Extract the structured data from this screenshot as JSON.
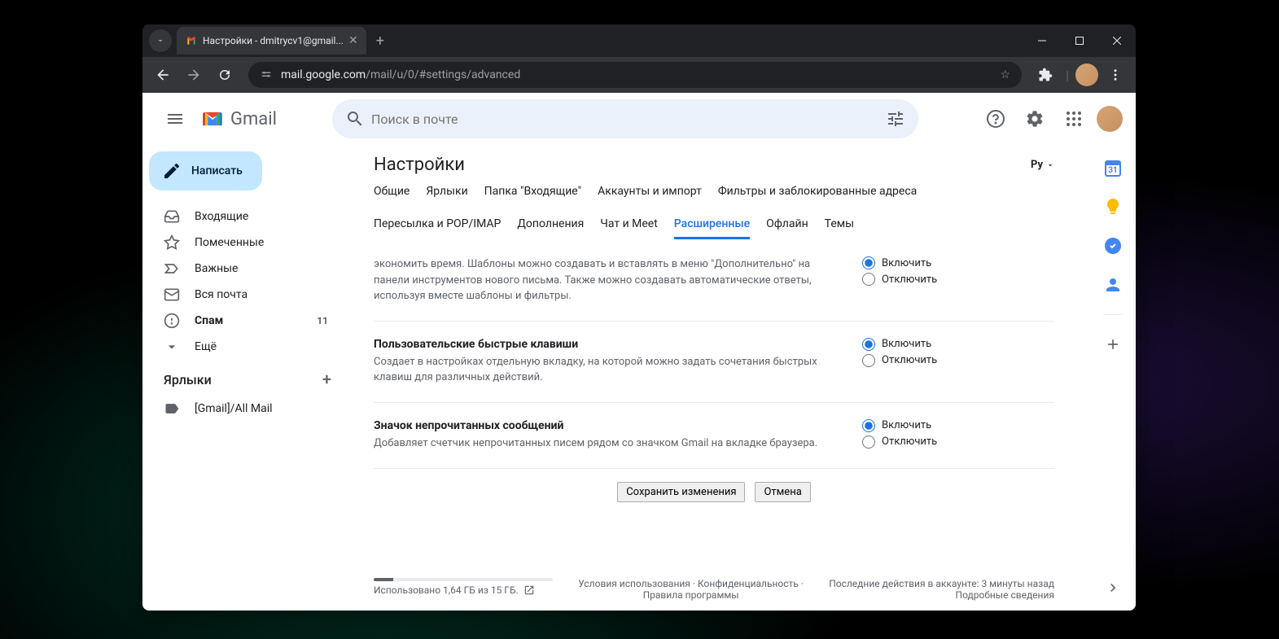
{
  "browser": {
    "tab_title": "Настройки - dmitrycv1@gmail...",
    "url_domain": "mail.google.com",
    "url_path": "/mail/u/0/#settings/advanced"
  },
  "header": {
    "app_name": "Gmail",
    "search_placeholder": "Поиск в почте"
  },
  "sidebar": {
    "compose": "Написать",
    "items": [
      {
        "label": "Входящие",
        "icon": "inbox"
      },
      {
        "label": "Помеченные",
        "icon": "star"
      },
      {
        "label": "Важные",
        "icon": "important"
      },
      {
        "label": "Вся почта",
        "icon": "mail"
      },
      {
        "label": "Спам",
        "icon": "spam",
        "count": "11",
        "bold": true
      },
      {
        "label": "Ещё",
        "icon": "expand"
      }
    ],
    "labels_header": "Ярлыки",
    "labels": [
      {
        "label": "[Gmail]/All Mail"
      }
    ]
  },
  "settings": {
    "title": "Настройки",
    "language": "Ру",
    "tabs": [
      "Общие",
      "Ярлыки",
      "Папка \"Входящие\"",
      "Аккаунты и импорт",
      "Фильтры и заблокированные адреса",
      "Пересылка и POP/IMAP",
      "Дополнения",
      "Чат и Meet",
      "Расширенные",
      "Офлайн",
      "Темы"
    ],
    "active_tab": "Расширенные",
    "rows": [
      {
        "title": "",
        "text": "экономить время. Шаблоны можно создавать и вставлять в меню \"Дополнительно\" на панели инструментов нового письма. Также можно создавать автоматические ответы, используя вместе шаблоны и фильтры.",
        "enable": "Включить",
        "disable": "Отключить",
        "selected": "enable"
      },
      {
        "title": "Пользовательские быстрые клавиши",
        "text": "Создает в настройках отдельную вкладку, на которой можно задать сочетания быстрых клавиш для различных действий.",
        "enable": "Включить",
        "disable": "Отключить",
        "selected": "enable"
      },
      {
        "title": "Значок непрочитанных сообщений",
        "text": "Добавляет счетчик непрочитанных писем рядом со значком Gmail на вкладке браузера.",
        "enable": "Включить",
        "disable": "Отключить",
        "selected": "enable"
      }
    ],
    "save_button": "Сохранить изменения",
    "cancel_button": "Отмена"
  },
  "footer": {
    "storage": "Использовано 1,64 ГБ из 15 ГБ.",
    "terms": "Условия использования",
    "privacy": "Конфиденциальность",
    "policies": "Правила программы",
    "activity": "Последние действия в аккаунте: 3 минуты назад",
    "details": "Подробные сведения"
  }
}
